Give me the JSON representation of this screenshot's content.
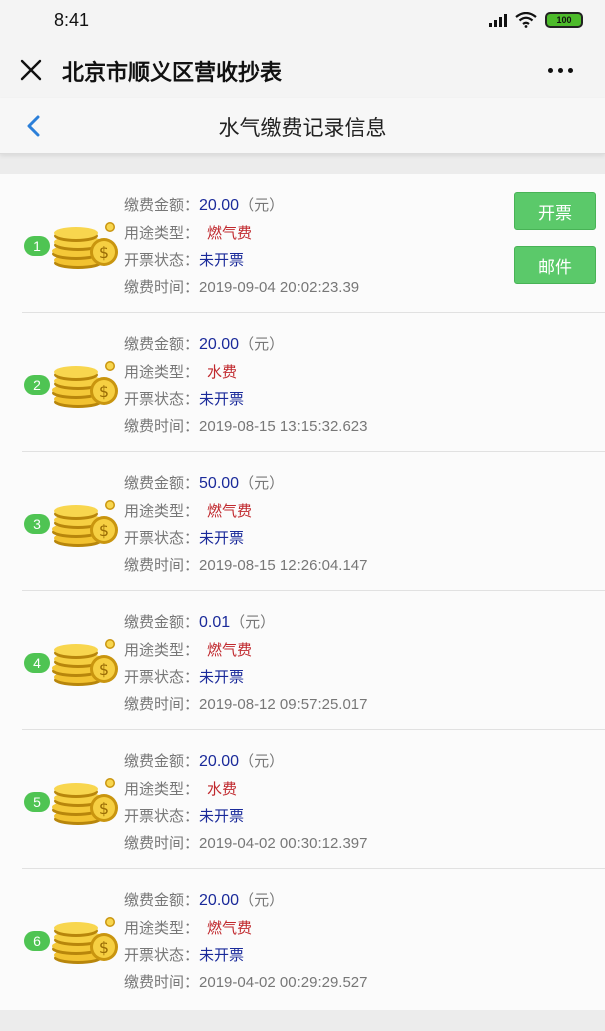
{
  "status_bar": {
    "time": "8:41",
    "battery": "100"
  },
  "title_bar": {
    "app_title": "北京市顺义区营收抄表"
  },
  "page_header": {
    "title": "水气缴费记录信息"
  },
  "labels": {
    "amount": "缴费金额：",
    "type": "用途类型：",
    "invoice_status": "开票状态：",
    "time": "缴费时间："
  },
  "records": [
    {
      "index": "1",
      "amount": "20.00",
      "unit": "（元）",
      "type": "燃气费",
      "invoice_status": "未开票",
      "time": "2019-09-04 20:02:23.39"
    },
    {
      "index": "2",
      "amount": "20.00",
      "unit": "（元）",
      "type": "水费",
      "invoice_status": "未开票",
      "time": "2019-08-15 13:15:32.623"
    },
    {
      "index": "3",
      "amount": "50.00",
      "unit": "（元）",
      "type": "燃气费",
      "invoice_status": "未开票",
      "time": "2019-08-15 12:26:04.147"
    },
    {
      "index": "4",
      "amount": "0.01",
      "unit": "（元）",
      "type": "燃气费",
      "invoice_status": "未开票",
      "time": "2019-08-12 09:57:25.017"
    },
    {
      "index": "5",
      "amount": "20.00",
      "unit": "（元）",
      "type": "水费",
      "invoice_status": "未开票",
      "time": "2019-04-02 00:30:12.397"
    },
    {
      "index": "6",
      "amount": "20.00",
      "unit": "（元）",
      "type": "燃气费",
      "invoice_status": "未开票",
      "time": "2019-04-02 00:29:29.527"
    }
  ],
  "actions": {
    "invoice_label": "开票",
    "mail_label": "邮件"
  },
  "colors": {
    "accent_green": "#5bc96a",
    "value_blue": "#1a2a9a",
    "type_red": "#c0282d",
    "back_blue": "#2b7fd9"
  }
}
